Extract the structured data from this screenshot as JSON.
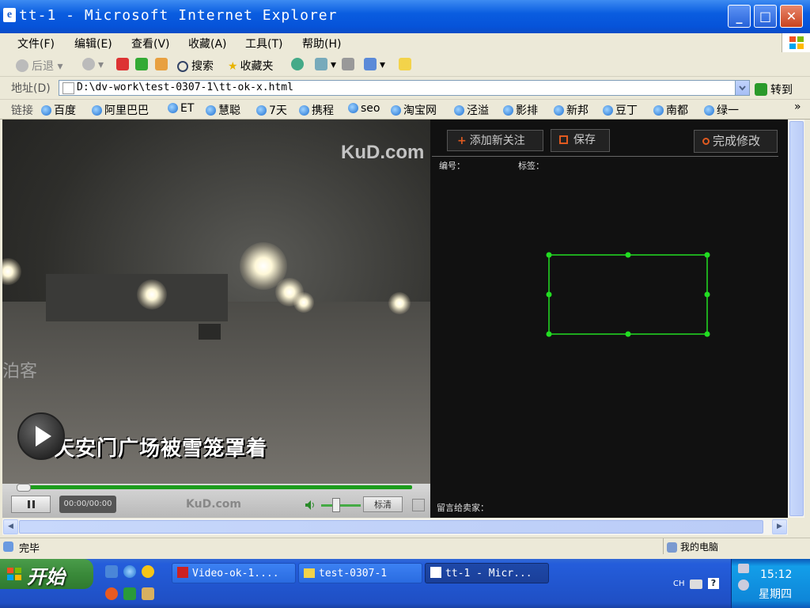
{
  "window": {
    "title": "tt-1 - Microsoft Internet Explorer"
  },
  "menu": [
    "文件(F)",
    "编辑(E)",
    "查看(V)",
    "收藏(A)",
    "工具(T)",
    "帮助(H)"
  ],
  "toolbar": {
    "back": "后退",
    "search": "搜索",
    "favorites": "收藏夹"
  },
  "address": {
    "label": "地址(D)",
    "url": "D:\\dv-work\\test-0307-1\\tt-ok-x.html",
    "go": "转到"
  },
  "links": {
    "label": "链接",
    "items": [
      "百度",
      "阿里巴巴",
      "ET",
      "慧聪",
      "7天",
      "携程",
      "seo",
      "淘宝网",
      "泾溢",
      "影排",
      "新邦",
      "豆丁",
      "南都",
      "绿一"
    ]
  },
  "video": {
    "logo": "KuD.com",
    "watermark": "泊客",
    "caption": "天安门广场被雪笼罩着",
    "time": "00:00/00:00",
    "small_logo": "KuD.com",
    "quality": "标清"
  },
  "panel": {
    "add_button": "添加新关注",
    "save_button": "保存",
    "finish_button": "完成修改",
    "number_label": "编号：",
    "tag_label": "标签：",
    "leave_message": "留言给卖家："
  },
  "status": {
    "left": "完毕",
    "zone": "我的电脑"
  },
  "taskbar": {
    "start": "开始",
    "tasks": [
      "Video-ok-1....",
      "test-0307-1",
      "tt-1 - Micr..."
    ],
    "lang": "CH",
    "clock": "15:12",
    "day": "星期四"
  }
}
